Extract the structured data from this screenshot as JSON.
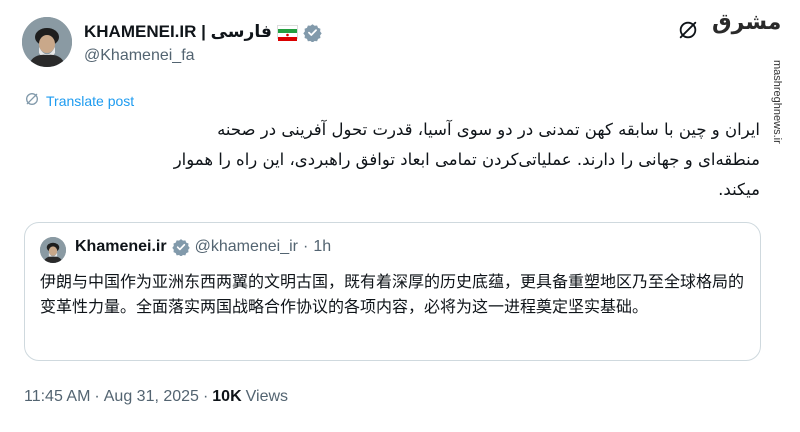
{
  "author": {
    "name": "KHAMENEI.IR | فارسی",
    "handle": "@Khamenei_fa"
  },
  "watermark": {
    "logo_text": "مشرق",
    "url": "mashreghnews.ir"
  },
  "translate_label": "Translate post",
  "tweet_text": "ایران و چین با سابقه کهن تمدنی در دو سوی آسیا، قدرت تحول آفرینی در صحنه منطقه‌ای و جهانی را دارند. عملیاتی‌کردن تمامی ابعاد توافق راهبردی، این راه را هموار میکند.",
  "quote": {
    "name": "Khamenei.ir",
    "handle": "@khamenei_ir",
    "separator": "·",
    "time": "1h",
    "text": "伊朗与中国作为亚洲东西两翼的文明古国，既有着深厚的历史底蕴，更具备重塑地区乃至全球格局的变革性力量。全面落实两国战略合作协议的各项内容，必将为这一进程奠定坚实基础。"
  },
  "footer": {
    "time": "11:45 AM",
    "sep1": "·",
    "date": "Aug 31, 2025",
    "sep2": "·",
    "views_count": "10K",
    "views_label": "Views"
  },
  "colors": {
    "accent": "#1d9bf0",
    "secondary_text": "#536471",
    "border": "#cfd9de",
    "verified": "#829aab"
  }
}
